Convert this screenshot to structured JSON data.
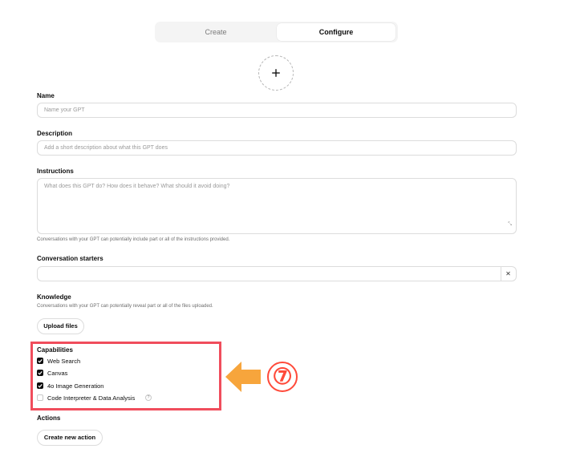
{
  "tabs": [
    {
      "label": "Create",
      "active": false
    },
    {
      "label": "Configure",
      "active": true
    }
  ],
  "avatar": {
    "icon": "plus-icon"
  },
  "name": {
    "label": "Name",
    "placeholder": "Name your GPT"
  },
  "description": {
    "label": "Description",
    "placeholder": "Add a short description about what this GPT does"
  },
  "instructions": {
    "label": "Instructions",
    "placeholder": "What does this GPT do? How does it behave? What should it avoid doing?",
    "hint": "Conversations with your GPT can potentially include part or all of the instructions provided."
  },
  "conversation_starters": {
    "label": "Conversation starters",
    "value": "",
    "clear_icon": "✕"
  },
  "knowledge": {
    "label": "Knowledge",
    "hint": "Conversations with your GPT can potentially reveal part or all of the files uploaded.",
    "upload_label": "Upload files"
  },
  "capabilities": {
    "label": "Capabilities",
    "items": [
      {
        "label": "Web Search",
        "checked": true
      },
      {
        "label": "Canvas",
        "checked": true
      },
      {
        "label": "4o Image Generation",
        "checked": true
      },
      {
        "label": "Code Interpreter & Data Analysis",
        "checked": false,
        "info_icon": "?"
      }
    ]
  },
  "actions": {
    "label": "Actions",
    "button_label": "Create new action"
  },
  "annotation": {
    "step": "⑦",
    "highlight_color": "#f04d5c",
    "arrow_color": "#f7a53c",
    "badge_color": "#ff4a3a"
  }
}
